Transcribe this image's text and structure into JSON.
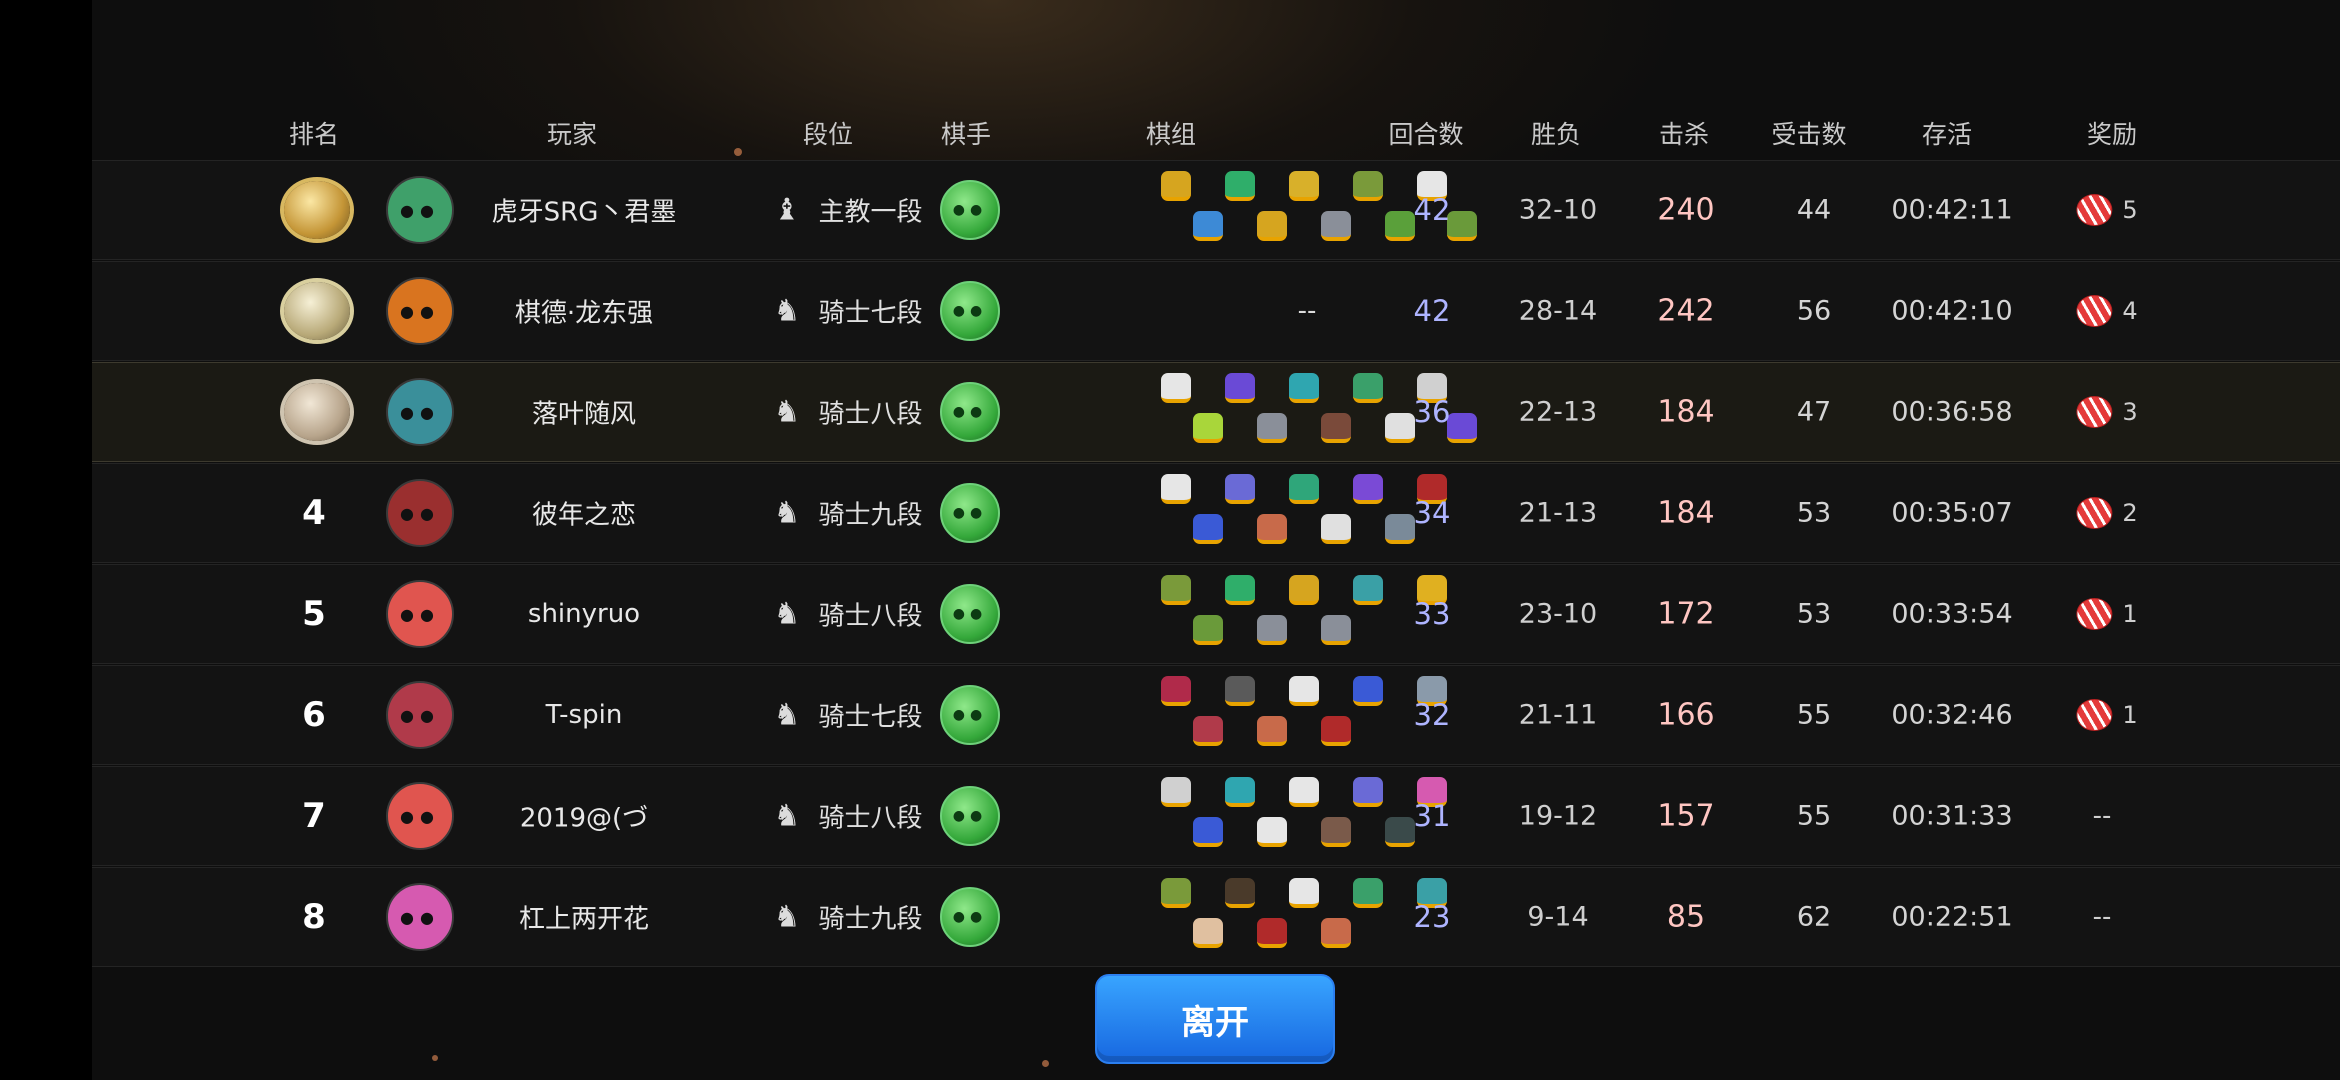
{
  "columns": {
    "rank": "排名",
    "player": "玩家",
    "tier": "段位",
    "chess_player": "棋手",
    "lineup": "棋组",
    "rounds": "回合数",
    "win_loss": "胜负",
    "kills": "击杀",
    "hits_taken": "受击数",
    "survival": "存活",
    "reward": "奖励"
  },
  "rows": [
    {
      "rank": "1",
      "name": "虎牙SRG丶君墨",
      "tier": "主教一段",
      "tier_icon": "bishop-icon",
      "lineup_text": "",
      "rounds": "42",
      "win_loss": "32-10",
      "kills": "240",
      "hits": "44",
      "survival": "00:42:11",
      "reward": "5",
      "avatar_color": "#3fa06a",
      "pieces": [
        "#d6a51f",
        "#2fae6a",
        "#d8b02a",
        "#7a9a3a",
        "#e6e6e6",
        "#3d8ad6",
        "#d6a51f",
        "#8a8f99",
        "#5aa03a",
        "#6a9a3a"
      ]
    },
    {
      "rank": "2",
      "name": "棋德·龙东强",
      "tier": "骑士七段",
      "tier_icon": "knight-icon",
      "lineup_text": "--",
      "rounds": "42",
      "win_loss": "28-14",
      "kills": "242",
      "hits": "56",
      "survival": "00:42:10",
      "reward": "4",
      "avatar_color": "#d9741f",
      "pieces": []
    },
    {
      "rank": "3",
      "name": "落叶随风",
      "tier": "骑士八段",
      "tier_icon": "knight-icon",
      "lineup_text": "",
      "rounds": "36",
      "win_loss": "22-13",
      "kills": "184",
      "hits": "47",
      "survival": "00:36:58",
      "reward": "3",
      "avatar_color": "#3a8f9a",
      "pieces": [
        "#e6e6e6",
        "#6a4ad6",
        "#2fa6b0",
        "#3aa06a",
        "#d0d0d0",
        "#a9d63a",
        "#8a8f99",
        "#7a4a3a",
        "#e0e0e0",
        "#6a4ad6"
      ]
    },
    {
      "rank": "4",
      "name": "彼年之恋",
      "tier": "骑士九段",
      "tier_icon": "knight-icon",
      "lineup_text": "",
      "rounds": "34",
      "win_loss": "21-13",
      "kills": "184",
      "hits": "53",
      "survival": "00:35:07",
      "reward": "2",
      "avatar_color": "#9a2f2f",
      "pieces": [
        "#e6e6e6",
        "#6a6ad6",
        "#2fa67a",
        "#7a4ad6",
        "#b02a2a",
        "#3a5ad6",
        "#c86a4a",
        "#e0e0e0",
        "#7a8a99"
      ]
    },
    {
      "rank": "5",
      "name": "shinyruo",
      "tier": "骑士八段",
      "tier_icon": "knight-icon",
      "lineup_text": "",
      "rounds": "33",
      "win_loss": "23-10",
      "kills": "172",
      "hits": "53",
      "survival": "00:33:54",
      "reward": "1",
      "avatar_color": "#e0554f",
      "pieces": [
        "#7a9a3a",
        "#2fae6a",
        "#d6a51f",
        "#3aa0a6",
        "#e0b020",
        "#6a9a3a",
        "#8a8f99",
        "#8a8f99"
      ]
    },
    {
      "rank": "6",
      "name": "T-spin",
      "tier": "骑士七段",
      "tier_icon": "knight-icon",
      "lineup_text": "",
      "rounds": "32",
      "win_loss": "21-11",
      "kills": "166",
      "hits": "55",
      "survival": "00:32:46",
      "reward": "1",
      "avatar_color": "#b03a4a",
      "pieces": [
        "#b02a4a",
        "#5a5a5a",
        "#e6e6e6",
        "#3a5ad6",
        "#8a9aaa",
        "#b03a4a",
        "#c86a4a",
        "#b02a2a"
      ]
    },
    {
      "rank": "7",
      "name": "2019@(づ",
      "tier": "骑士八段",
      "tier_icon": "knight-icon",
      "lineup_text": "",
      "rounds": "31",
      "win_loss": "19-12",
      "kills": "157",
      "hits": "55",
      "survival": "00:31:33",
      "reward": "--",
      "avatar_color": "#e0554f",
      "pieces": [
        "#d0d0d0",
        "#2fa6b0",
        "#e6e6e6",
        "#6a6ad6",
        "#d65ab0",
        "#3a5ad6",
        "#e6e6e6",
        "#7a5a4a",
        "#3a4a4a"
      ]
    },
    {
      "rank": "8",
      "name": "杠上两开花",
      "tier": "骑士九段",
      "tier_icon": "knight-icon",
      "lineup_text": "",
      "rounds": "23",
      "win_loss": "9-14",
      "kills": "85",
      "hits": "62",
      "survival": "00:22:51",
      "reward": "--",
      "avatar_color": "#d65ab0",
      "pieces": [
        "#7a9a3a",
        "#4a3a2a",
        "#e6e6e6",
        "#3aa06a",
        "#3aa0a6",
        "#e0c0a0",
        "#b02a2a",
        "#c86a4a"
      ]
    }
  ],
  "leave_button": "离开",
  "icons": {
    "chess_player": "green-ogre-head-icon",
    "reward": "red-white-ball-icon",
    "bishop": "bishop-icon",
    "knight": "knight-icon"
  },
  "colors": {
    "rounds": "#aeb4ff",
    "kills": "#ffc6c2",
    "leave_button": "#1f7cf0"
  }
}
